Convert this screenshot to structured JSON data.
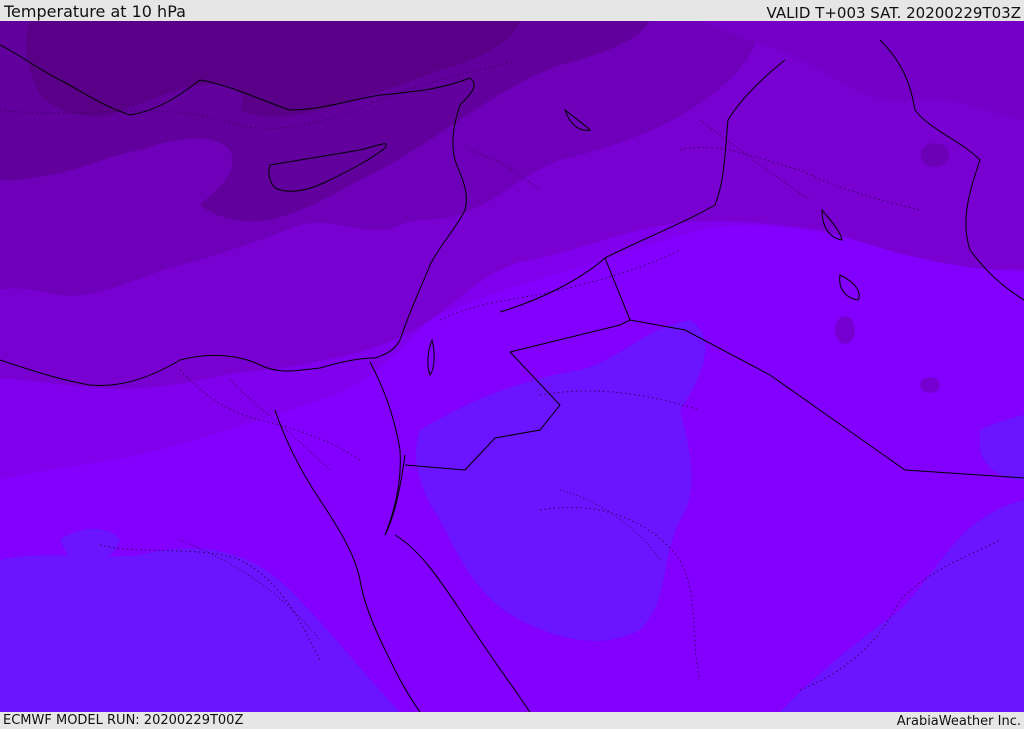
{
  "header": {
    "title": "Temperature at 10 hPa",
    "valid_time": "VALID T+003 SAT. 20200229T03Z"
  },
  "footer": {
    "model_run": "ECMWF MODEL RUN: 20200229T00Z",
    "credit": "ArabiaWeather Inc."
  },
  "map": {
    "field": "temperature",
    "level": "10 hPa",
    "shading": {
      "darkest_north": "#5e0090",
      "dark": "#6a04a8",
      "mid": "#7500bf",
      "violet": "#7d00d8",
      "light_violet": "#8000f0",
      "brightest": "#8300ff",
      "bluish": "#6a12ff"
    },
    "boundaries_color": "#000000"
  }
}
